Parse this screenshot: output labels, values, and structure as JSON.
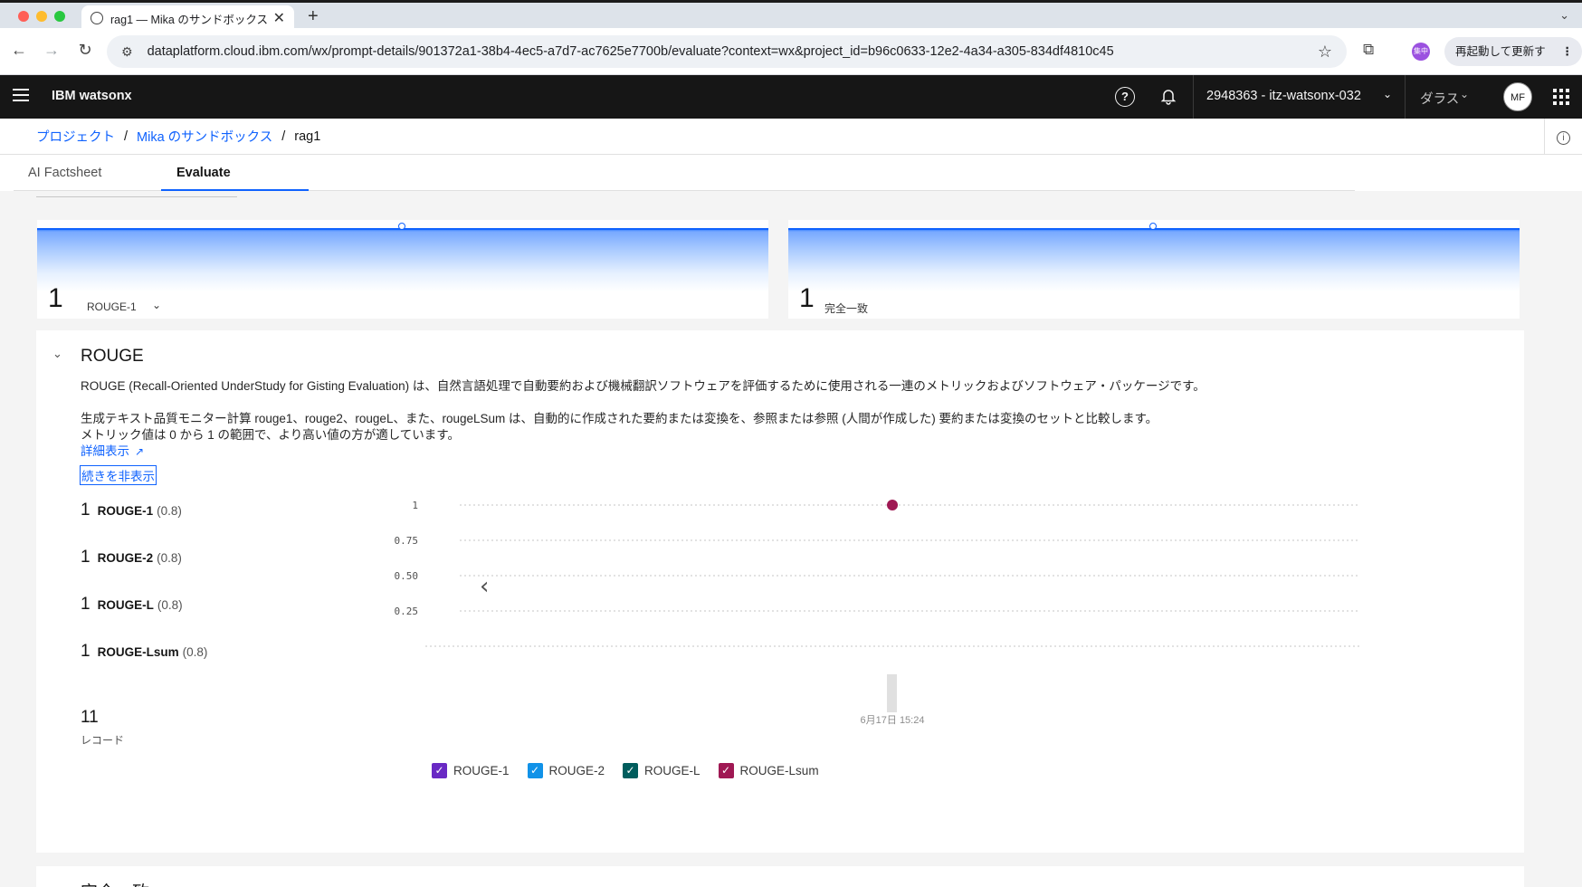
{
  "browser": {
    "tab_title": "rag1 — Mika のサンドボックス",
    "tab_close": "✕",
    "new_tab": "+",
    "url": "dataplatform.cloud.ibm.com/wx/prompt-details/901372a1-38b4-4ec5-a7d7-ac7625e7700b/evaluate?context=wx&project_id=b96c0633-12e2-4a34-a305-834df4810c45",
    "relaunch_label": "再起動して更新する",
    "relaunch_menu": "⋮",
    "profile_badge": "集中",
    "nav_back": "←",
    "nav_forward": "→",
    "nav_reload": "↻",
    "star": "☆",
    "tab_strip_menu": "⌄"
  },
  "header": {
    "product": "IBM watsonx",
    "help": "?",
    "account": "2948363 - itz-watsonx-032",
    "region": "ダラス",
    "avatar": "MF"
  },
  "breadcrumb": {
    "items": [
      "プロジェクト",
      "Mika のサンドボックス",
      "rag1"
    ],
    "separator": "/"
  },
  "tabs": [
    {
      "label": "AI Factsheet"
    },
    {
      "label": "Evaluate"
    }
  ],
  "tiles": [
    {
      "value": "1",
      "label": "ROUGE-1",
      "level": 1.0
    },
    {
      "value": "1",
      "label": "完全一致",
      "level": 1.0
    }
  ],
  "rouge": {
    "title": "ROUGE",
    "description1": "ROUGE (Recall-Oriented UnderStudy for Gisting Evaluation) は、自然言語処理で自動要約および機械翻訳ソフトウェアを評価するために使用される一連のメトリックおよびソフトウェア・パッケージです。",
    "description2": "生成テキスト品質モニター計算 rouge1、rouge2、rougeL、また、rougeLSum は、自動的に作成された要約または変換を、参照または参照 (人間が作成した) 要約または変換のセットと比較します。",
    "description3": "メトリック値は 0 から 1 の範囲で、より高い値の方が適しています。",
    "more_link": "詳細表示",
    "hide_link": "続きを非表示",
    "metrics": [
      {
        "value": "1",
        "name": "ROUGE-1",
        "threshold": "(0.8)"
      },
      {
        "value": "1",
        "name": "ROUGE-2",
        "threshold": "(0.8)"
      },
      {
        "value": "1",
        "name": "ROUGE-L",
        "threshold": "(0.8)"
      },
      {
        "value": "1",
        "name": "ROUGE-Lsum",
        "threshold": "(0.8)"
      }
    ],
    "records_value": "11",
    "records_label": "レコード"
  },
  "chart_data": {
    "type": "scatter",
    "ylim": [
      0,
      1
    ],
    "y_ticks": [
      "1",
      "0.75",
      "0.50",
      "0.25"
    ],
    "x": [
      "6月17日 15:24"
    ],
    "series": [
      {
        "name": "ROUGE-Lsum",
        "values": [
          1
        ],
        "color": "#9f1853"
      }
    ],
    "legend": [
      {
        "name": "ROUGE-1",
        "color": "#6929c4"
      },
      {
        "name": "ROUGE-2",
        "color": "#1192e8"
      },
      {
        "name": "ROUGE-L",
        "color": "#005d5d"
      },
      {
        "name": "ROUGE-Lsum",
        "color": "#9f1853"
      }
    ],
    "legend_position": "bottom",
    "grid": true,
    "prev_button": "‹"
  },
  "next_section_title": "完全一致"
}
